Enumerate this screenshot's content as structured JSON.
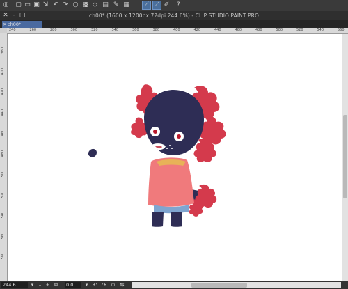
{
  "window": {
    "title": "ch00* (1600 x 1200px 72dpi 244.6%) - CLIP STUDIO PAINT PRO"
  },
  "tabs": [
    {
      "label": "ch00*"
    }
  ],
  "ruler": {
    "horizontal": [
      "240",
      "260",
      "280",
      "300",
      "320",
      "340",
      "360",
      "380",
      "400",
      "420",
      "440",
      "460",
      "480",
      "500",
      "520",
      "540",
      "560"
    ],
    "vertical": [
      "380",
      "400",
      "420",
      "440",
      "460",
      "480",
      "500",
      "520",
      "540",
      "560",
      "580"
    ]
  },
  "status": {
    "zoom": "244.6",
    "angle": "0.0"
  },
  "icons": {
    "toolbar": [
      "menu-icon",
      "new-file-icon",
      "open-icon",
      "save-icon",
      "export-icon",
      "undo-icon",
      "redo-icon",
      "clear-icon",
      "fill-icon",
      "transform-icon",
      "layer-icon",
      "pen-icon",
      "selection-icon",
      "brush-icon",
      "eraser-icon",
      "help-icon"
    ],
    "status": [
      "zoom-out-icon",
      "zoom-in-icon",
      "fit-icon",
      "rotate-left-icon",
      "reset-rotation-icon",
      "rotate-right-icon",
      "flip-icon"
    ]
  },
  "colors": {
    "accent": "#4a6aa0",
    "leaf": "#d43a4c",
    "head": "#2e2d55",
    "shirt": "#f07a7c",
    "pants": "#7fa5d0"
  }
}
